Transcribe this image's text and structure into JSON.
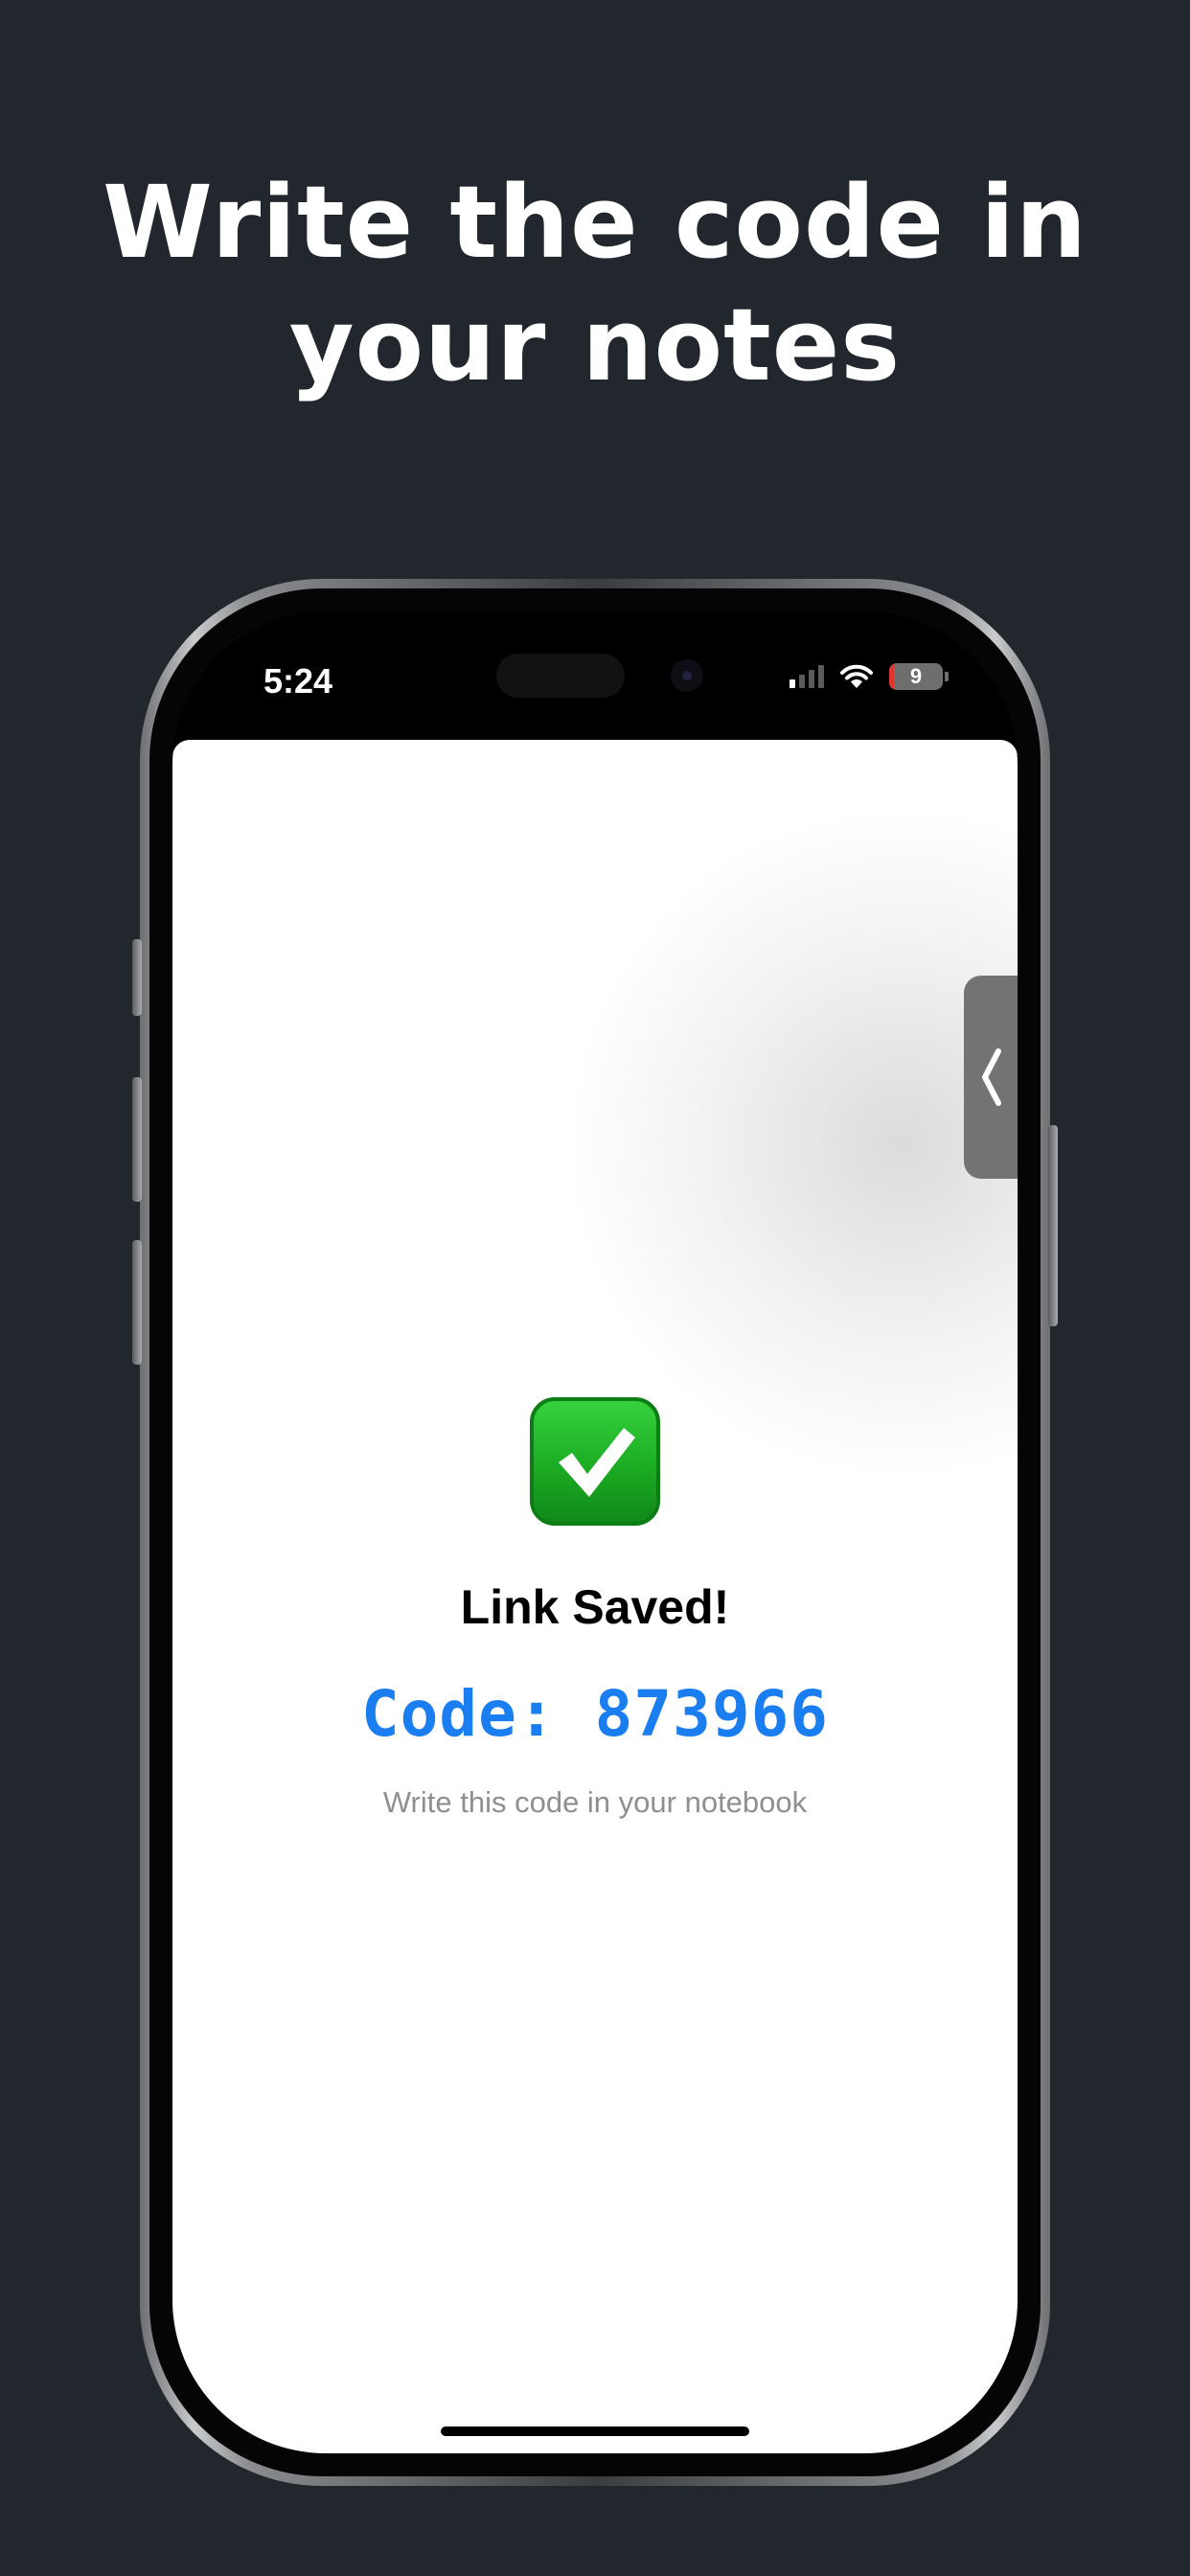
{
  "headline": {
    "line1": "Write the code in",
    "line2": "your notes"
  },
  "status_bar": {
    "time": "5:24",
    "battery_level": "9",
    "battery_fraction": 0.09,
    "signal_bars_active": 1,
    "icons": [
      "cellular-signal-icon",
      "wifi-icon",
      "battery-icon"
    ]
  },
  "screen": {
    "edge_handle_icon": "chevron-left-icon",
    "success_icon": "check-mark-button-icon",
    "title": "Link Saved!",
    "code_label": "Code:",
    "code_value": "873966",
    "hint": "Write this code in your notebook"
  },
  "colors": {
    "background": "#22262d",
    "code": "#1a7df0",
    "hint": "#8e8e93",
    "check": "#1aa821"
  }
}
